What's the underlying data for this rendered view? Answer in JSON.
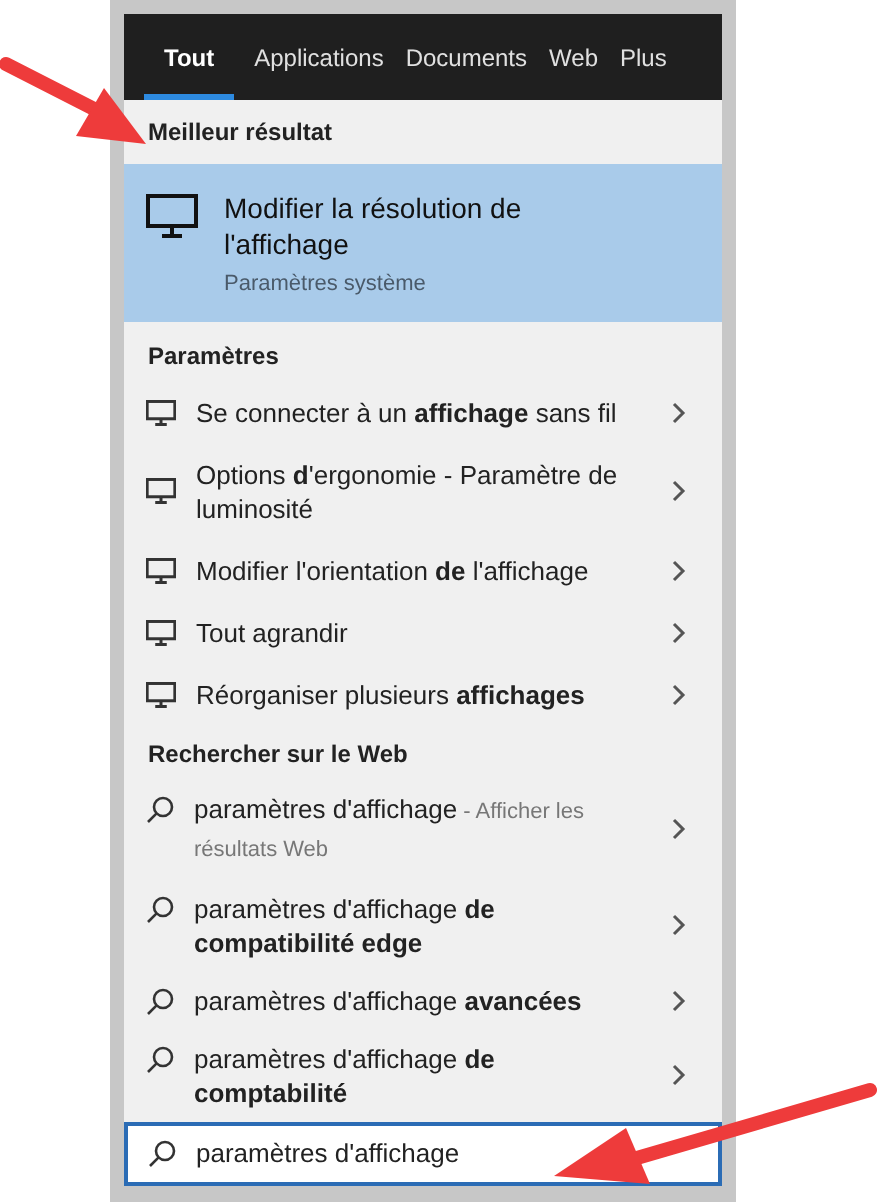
{
  "tabs": [
    {
      "label": "Tout",
      "selected": true
    },
    {
      "label": "Applications",
      "selected": false
    },
    {
      "label": "Documents",
      "selected": false
    },
    {
      "label": "Web",
      "selected": false
    },
    {
      "label": "Plus",
      "selected": false
    }
  ],
  "best": {
    "heading": "Meilleur résultat",
    "title": "Modifier la résolution de l'affichage",
    "subtitle": "Paramètres système"
  },
  "settings": {
    "heading": "Paramètres",
    "items": [
      {
        "text": "Se connecter à un **affichage** sans fil"
      },
      {
        "text": "Options **d**'ergonomie - Paramètre de luminosité"
      },
      {
        "text": "Modifier l'orientation **de** l'affichage"
      },
      {
        "text": "Tout agrandir"
      },
      {
        "text": "Réorganiser plusieurs **affichages**"
      }
    ]
  },
  "web": {
    "heading": "Rechercher sur le Web",
    "items": [
      {
        "text": "paramètres d'affichage",
        "suffix": "- Afficher les résultats Web"
      },
      {
        "text": "paramètres d'affichage **de compatibilité edge**"
      },
      {
        "text": "paramètres d'affichage **avancées**"
      },
      {
        "text": "paramètres d'affichage **de comptabilité**"
      }
    ]
  },
  "search": {
    "value": "paramètres d'affichage"
  }
}
